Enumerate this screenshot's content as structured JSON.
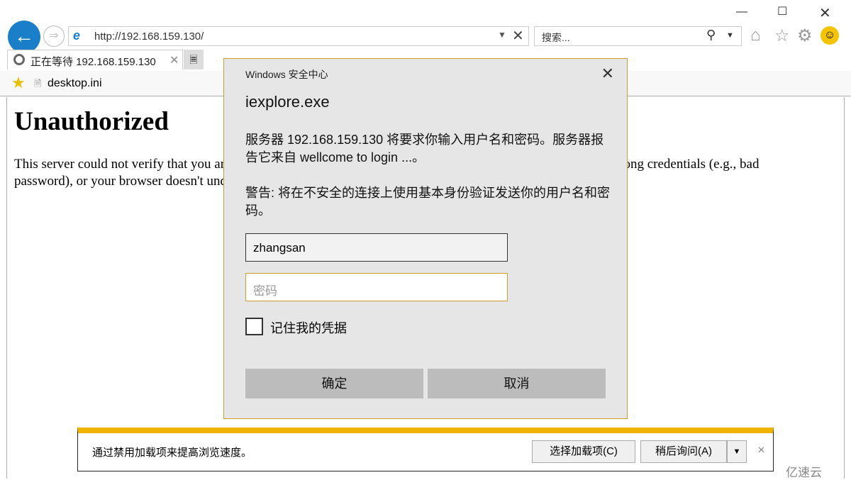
{
  "browser": {
    "url": "http://192.168.159.130/",
    "search_placeholder": "搜索...",
    "tab_title": "正在等待 192.168.159.130",
    "favorite": "desktop.ini"
  },
  "page": {
    "heading": "Unauthorized",
    "text": "This server could not verify that you are authorized to access the document requested. Either you supplied the wrong credentials (e.g., bad password), or your browser doesn't understand how to supply the credentials required."
  },
  "dialog": {
    "title": "Windows 安全中心",
    "app": "iexplore.exe",
    "message": "服务器 192.168.159.130 将要求你输入用户名和密码。服务器报告它来自 wellcome to login ...。",
    "warning": "警告: 将在不安全的连接上使用基本身份验证发送你的用户名和密码。",
    "username": "zhangsan",
    "password_placeholder": "密码",
    "remember": "记住我的凭据",
    "ok": "确定",
    "cancel": "取消"
  },
  "notification": {
    "message": "通过禁用加载项来提高浏览速度。",
    "choose": "选择加载项(C)",
    "later": "稍后询问(A)"
  },
  "watermark": "亿速云"
}
